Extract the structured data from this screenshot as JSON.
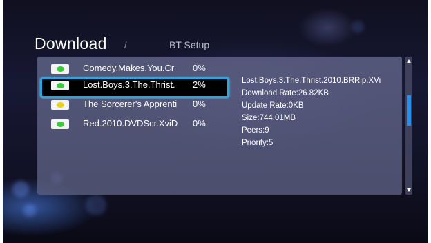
{
  "header": {
    "title": "Download",
    "separator": "/",
    "subtitle": "BT Setup"
  },
  "downloads": [
    {
      "name": "Comedy.Makes.You.Cr",
      "percent": "0%",
      "status_color": "#3cc83c",
      "selected": false
    },
    {
      "name": "Lost.Boys.3.The.Thrist.",
      "percent": "2%",
      "status_color": "#3cc83c",
      "selected": true
    },
    {
      "name": "The Sorcerer's Apprenti",
      "percent": "0%",
      "status_color": "#e8d020",
      "selected": false
    },
    {
      "name": "Red.2010.DVDScr.XviD",
      "percent": "0%",
      "status_color": "#3cc83c",
      "selected": false
    }
  ],
  "details": {
    "filename": "Lost.Boys.3.The.Thrist.2010.BRRip.XVi",
    "download_rate": "Download Rate:26.82KB",
    "update_rate": "Update Rate:0KB",
    "size": "Size:744.01MB",
    "peers": "Peers:9",
    "priority": "Priority:5"
  },
  "colors": {
    "selection_border": "#27a8e0",
    "scroll_thumb": "#2a8fe8"
  },
  "icons": {
    "status": "status-led-icon",
    "scroll_up": "triangle-up-icon",
    "scroll_down": "triangle-down-icon"
  }
}
